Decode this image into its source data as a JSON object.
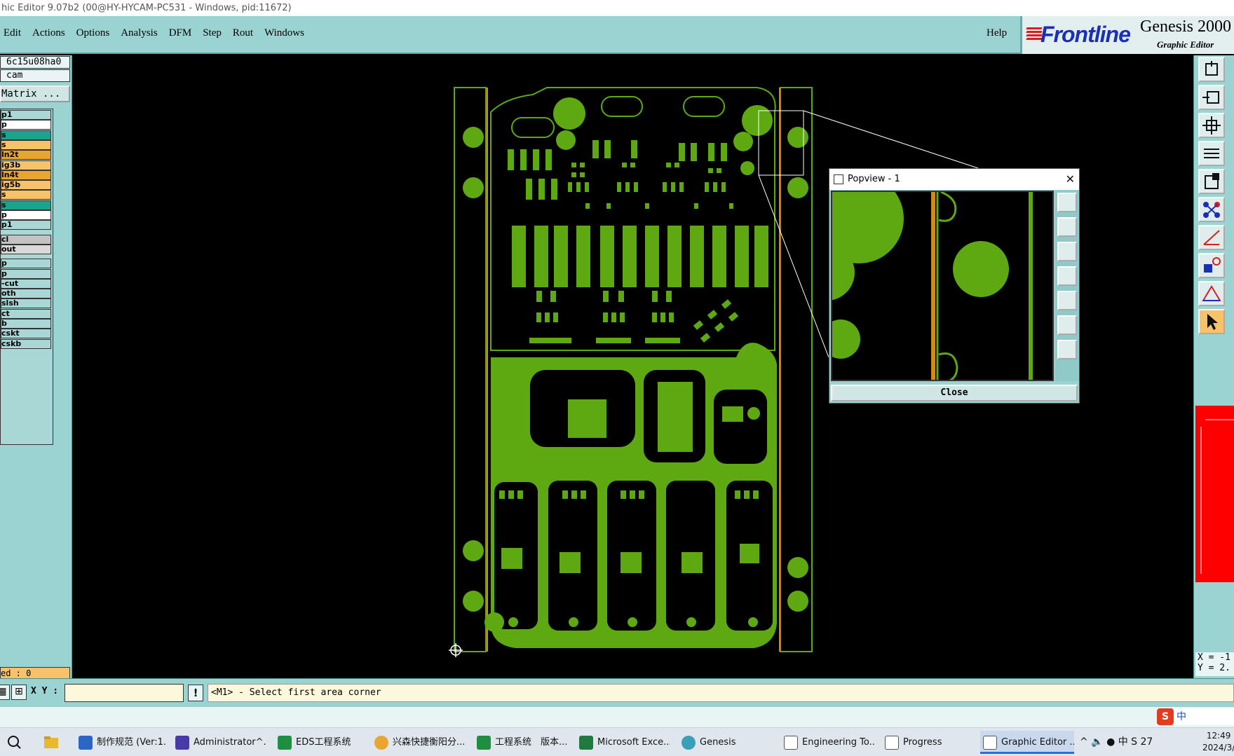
{
  "window": {
    "title": "hic Editor 9.07b2 (00@HY-HYCAM-PC531 - Windows, pid:11672)"
  },
  "menubar": {
    "items": [
      "Edit",
      "Actions",
      "Options",
      "Analysis",
      "DFM",
      "Step",
      "Rout",
      "Windows"
    ],
    "help": "Help"
  },
  "brand": {
    "logo": "Frontline",
    "product": "Genesis 2000",
    "subtitle": "Graphic Editor"
  },
  "left_panel": {
    "job": "6c15u08ha0",
    "step": "cam",
    "matrix_button": "Matrix ...",
    "layers": [
      {
        "label": "p1",
        "color": "#a9d7d5"
      },
      {
        "label": "p",
        "color": "#ffffff"
      },
      {
        "label": "s",
        "color": "#1aa38d"
      },
      {
        "label": "s",
        "color": "#f7c26a"
      },
      {
        "label": "ln2t",
        "color": "#e8a630"
      },
      {
        "label": "ig3b",
        "color": "#f7c26a"
      },
      {
        "label": "ln4t",
        "color": "#e8a630"
      },
      {
        "label": "ig5b",
        "color": "#f7c26a"
      },
      {
        "label": "s",
        "color": "#f7c26a"
      },
      {
        "label": "s",
        "color": "#1aa38d"
      },
      {
        "label": "p",
        "color": "#ffffff"
      },
      {
        "label": "p1",
        "color": "#a9d7d5"
      },
      {
        "label": "cl",
        "color": "#c3c3c3"
      },
      {
        "label": "out",
        "color": "#d9d9d9"
      },
      {
        "label": "p",
        "color": "#a9d7d5"
      },
      {
        "label": "p",
        "color": "#a9d7d5"
      },
      {
        "label": "-cut",
        "color": "#a9d7d5"
      },
      {
        "label": "oth",
        "color": "#a9d7d5"
      },
      {
        "label": "slsh",
        "color": "#a9d7d5"
      },
      {
        "label": "ct",
        "color": "#a9d7d5"
      },
      {
        "label": "b",
        "color": "#a9d7d5"
      },
      {
        "label": "cskt",
        "color": "#a9d7d5"
      },
      {
        "label": "cskb",
        "color": "#a9d7d5"
      }
    ],
    "selected_count": "ed : 0"
  },
  "right_toolbar": {
    "coords": "X = -1\nY = 2."
  },
  "status": {
    "xy_label": "X Y :",
    "xy_value": "",
    "excl": "!",
    "prompt": "<M1> - Select first area corner"
  },
  "ime": {
    "badge": "S",
    "lang": "中"
  },
  "popview": {
    "title": "Popview - 1",
    "close_label": "Close"
  },
  "taskbar": {
    "items": [
      {
        "label": "制作规范 (Ver:1...",
        "icon_color": "#2b66c6"
      },
      {
        "label": "Administrator^...",
        "icon_color": "#4a3aa6"
      },
      {
        "label": "EDS工程系统",
        "icon_color": "#1e8f3f"
      },
      {
        "label": "兴森快捷衡阳分...",
        "icon_color": "#e8a630"
      },
      {
        "label": "工程系统　版本...",
        "icon_color": "#1e8f3f"
      },
      {
        "label": "Microsoft Exce...",
        "icon_color": "#1f7a3d"
      },
      {
        "label": "Genesis",
        "icon_color": "#3aa0b8"
      },
      {
        "label": "Engineering To...",
        "icon_color": "#ffffff"
      },
      {
        "label": "Progress",
        "icon_color": "#ffffff"
      },
      {
        "label": "Graphic Editor ...",
        "icon_color": "#ffffff"
      }
    ],
    "tray": "^  🔈  ●  中  S  27",
    "clock_time": "12:49",
    "clock_date": "2024/3/"
  },
  "colors": {
    "board_green": "#5ea812",
    "board_orange": "#d4890f",
    "panel_teal": "#9ad3d1"
  }
}
